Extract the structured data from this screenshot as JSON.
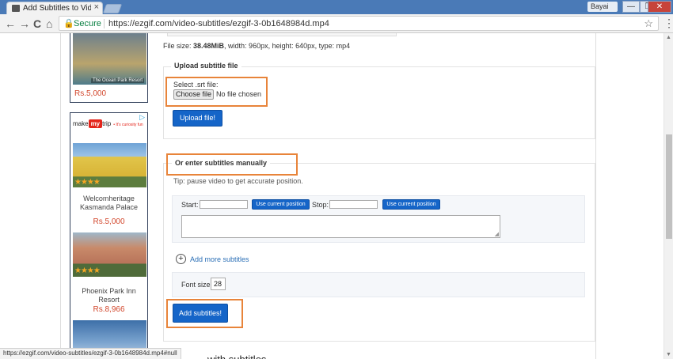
{
  "browser": {
    "tab_title": "Add Subtitles to Video o",
    "tab_close": "×",
    "profile": "Bayai",
    "win_min": "—",
    "win_max": "❐",
    "win_close": "✕",
    "secure_label": "Secure",
    "url": "https://ezgif.com/video-subtitles/ezgif-3-0b1648984d.mp4",
    "back": "←",
    "forward": "→",
    "reload": "C",
    "home": "⌂",
    "star": "☆",
    "menu": "⋮"
  },
  "sidebar": {
    "ad1": {
      "caption": "The Ocean Park Resort",
      "price": "Rs.5,000"
    },
    "ad2": {
      "adchoice": "▷",
      "brand_make": "make",
      "brand_my": "my",
      "brand_trip": "trip",
      "tagline": "• It's curiosity fun",
      "hotels": [
        {
          "name": "Welcomheritage Kasmanda Palace",
          "price": "Rs.5,000",
          "stars": "★★★★"
        },
        {
          "name": "Phoenix Park Inn Resort",
          "price": "Rs.8,966",
          "stars": "★★★★"
        }
      ]
    }
  },
  "main": {
    "file_size_prefix": "File size: ",
    "file_size_value": "38.48MiB",
    "file_size_rest": ", width: 960px, height: 640px, type: mp4",
    "upload_legend": "Upload subtitle file",
    "select_label": "Select .srt file:",
    "choose_file": "Choose file",
    "no_file": "No file chosen",
    "upload_button": "Upload file!",
    "manual_legend": "Or enter subtitles manually",
    "tip": "Tip: pause video to get accurate position.",
    "start_label": "Start:",
    "stop_label": "Stop:",
    "use_current": "Use current position",
    "add_more": "Add more subtitles",
    "font_size_label": "Font size:",
    "font_size_value": "28",
    "add_subtitles_button": "Add subtitles!",
    "bottom_heading": "with subtitles"
  },
  "status_bar": "https://ezgif.com/video-subtitles/ezgif-3-0b1648984d.mp4#null",
  "colors": {
    "accent_blue": "#1565c8",
    "highlight_orange": "#e8843a",
    "price_red": "#d2462b",
    "link_blue": "#2b6fb6"
  }
}
